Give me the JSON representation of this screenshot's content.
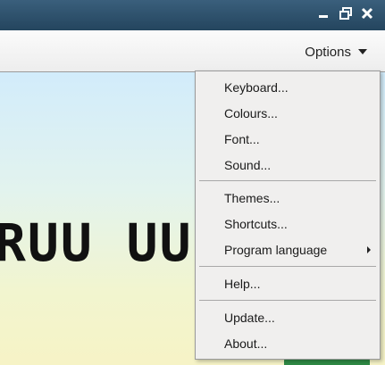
{
  "toolbar": {
    "options_label": "Options"
  },
  "content": {
    "practice_text": "RUU  UUR"
  },
  "menu": {
    "groups": [
      [
        "Keyboard...",
        "Colours...",
        "Font...",
        "Sound..."
      ],
      [
        "Themes...",
        "Shortcuts...",
        "Program language"
      ],
      [
        "Help..."
      ],
      [
        "Update...",
        "About..."
      ]
    ]
  }
}
